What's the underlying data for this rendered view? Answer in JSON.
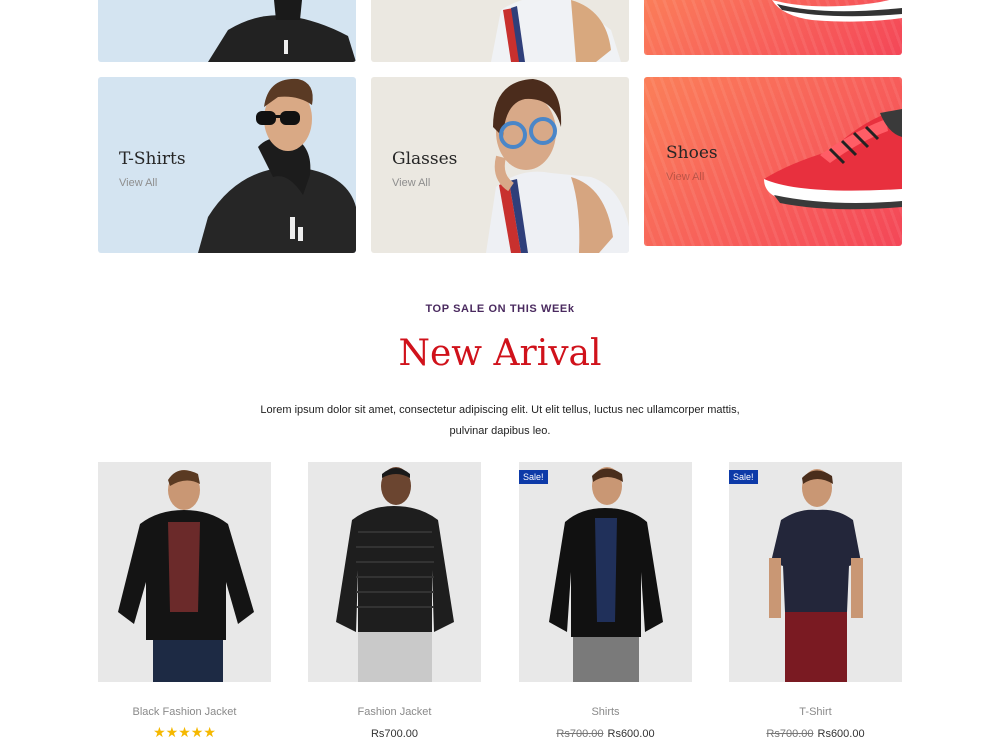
{
  "categories": [
    {
      "title": "T-Shirts",
      "link": "View All"
    },
    {
      "title": "Glasses",
      "link": "View All"
    },
    {
      "title": "Shoes",
      "link": "View All"
    }
  ],
  "section": {
    "subtitle": "TOP SALE ON THIS WEEk",
    "title": "New Arival",
    "description": "Lorem ipsum dolor sit amet, consectetur adipiscing elit. Ut elit tellus, luctus nec ullamcorper mattis, pulvinar dapibus leo."
  },
  "products": [
    {
      "name": "Black Fashion Jacket",
      "rating": "★★★★★",
      "price": "",
      "old_price": ""
    },
    {
      "name": "Fashion Jacket",
      "price": "Rs700.00",
      "old_price": ""
    },
    {
      "name": "Shirts",
      "price": "Rs600.00",
      "old_price": "Rs700.00",
      "badge": "Sale!"
    },
    {
      "name": "T-Shirt",
      "price": "Rs600.00",
      "old_price": "Rs700.00",
      "badge": "Sale!"
    }
  ],
  "colors": {
    "accent": "#d0121b",
    "sale_badge": "#0d3aa8",
    "star": "#f5b800"
  }
}
